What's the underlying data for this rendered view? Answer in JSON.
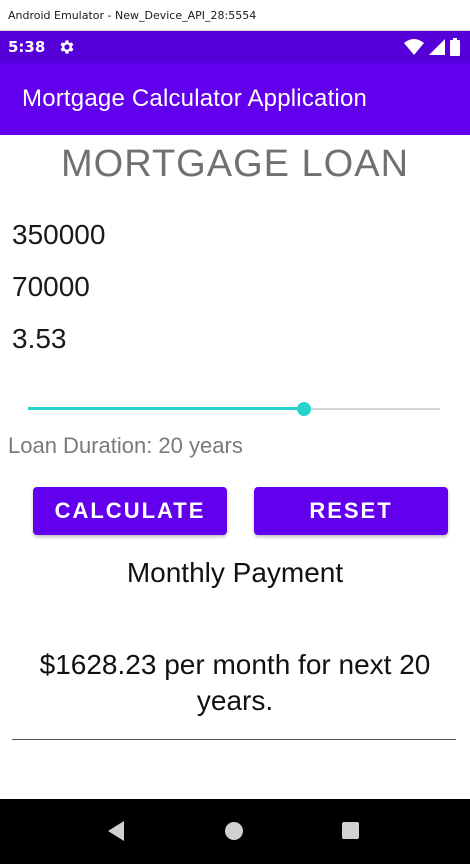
{
  "window": {
    "title": "Android Emulator - New_Device_API_28:5554"
  },
  "status_bar": {
    "time": "5:38",
    "left_icons": [
      "gear-icon"
    ],
    "right_icons": [
      "wifi-icon",
      "signal-icon",
      "battery-icon"
    ],
    "background_color": "#5500d9"
  },
  "app_bar": {
    "title": "Mortgage Calculator Application",
    "background_color": "#6200ee"
  },
  "main": {
    "heading": "MORTGAGE LOAN",
    "fields": {
      "loan_amount": "350000",
      "down_payment": "70000",
      "interest_rate": "3.53"
    },
    "slider": {
      "value_fraction": 0.67,
      "accent_color": "#26d4cc"
    },
    "duration_label": "Loan Duration: 20 years",
    "buttons": {
      "calculate_label": "CALCULATE",
      "reset_label": "RESET"
    },
    "payment_title": "Monthly Payment",
    "payment_result": "$1628.23 per month for next 20 years."
  },
  "nav_bar": {
    "icons": [
      "back-icon",
      "home-icon",
      "recents-icon"
    ]
  }
}
